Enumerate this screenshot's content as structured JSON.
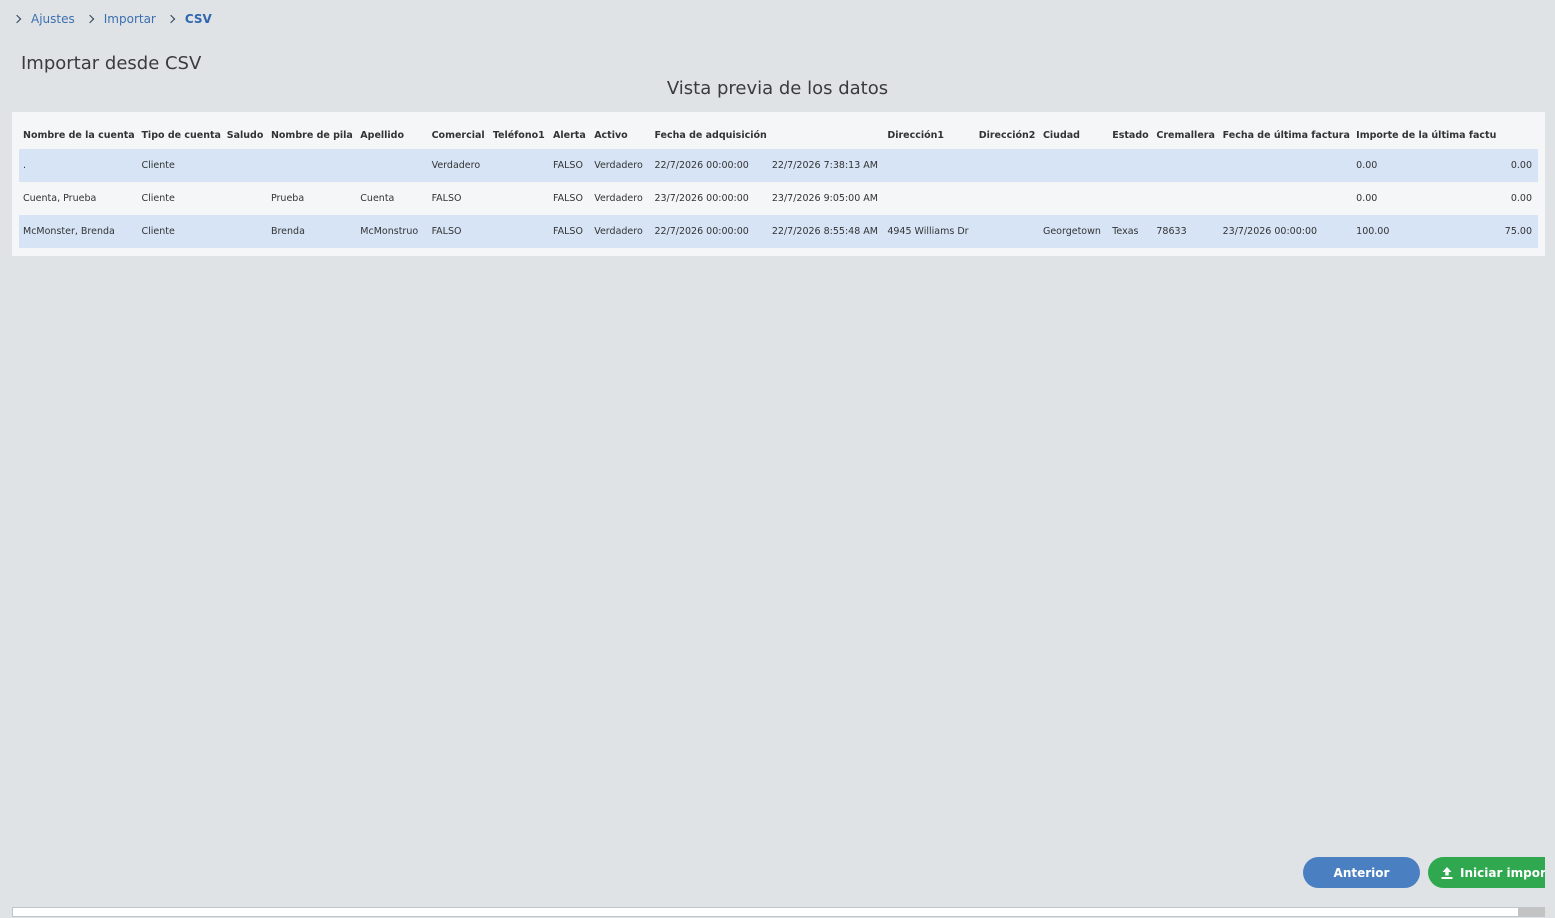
{
  "breadcrumb": {
    "items": [
      "Ajustes",
      "Importar",
      "CSV"
    ]
  },
  "page_title": "Importar desde CSV",
  "preview_title": "Vista previa de los datos",
  "table": {
    "headers": [
      "Nombre de la cuenta",
      "Tipo de cuenta",
      "Saludo",
      "Nombre de pila",
      "Apellido",
      "Comercial",
      "Teléfono1",
      "Alerta",
      "Activo",
      "Fecha de adquisición",
      "",
      "Dirección1",
      "Dirección2",
      "Ciudad",
      "Estado",
      "Cremallera",
      "Fecha de última factura",
      "Importe de la última factura",
      ""
    ],
    "rows": [
      [
        ".",
        "Cliente",
        "",
        "",
        "",
        "Verdadero",
        "",
        "FALSO",
        "Verdadero",
        "22/7/2026 00:00:00",
        "22/7/2026 7:38:13 AM",
        "",
        "",
        "",
        "",
        "",
        "",
        "0.00",
        "0.00"
      ],
      [
        "Cuenta, Prueba",
        "Cliente",
        "",
        "Prueba",
        "Cuenta",
        "FALSO",
        "",
        "FALSO",
        "Verdadero",
        "23/7/2026 00:00:00",
        "23/7/2026 9:05:00 AM",
        "",
        "",
        "",
        "",
        "",
        "",
        "0.00",
        "0.00"
      ],
      [
        "McMonster, Brenda",
        "Cliente",
        "",
        "Brenda",
        "McMonstruo",
        "FALSO",
        "",
        "FALSO",
        "Verdadero",
        "22/7/2026 00:00:00",
        "22/7/2026 8:55:48 AM",
        "4945 Williams Dr",
        "",
        "Georgetown",
        "Texas",
        "78633",
        "23/7/2026 00:00:00",
        "100.00",
        "75.00"
      ]
    ]
  },
  "buttons": {
    "previous": "Anterior",
    "start_import": "Iniciar importación"
  },
  "colors": {
    "accent_blue": "#4a7fc1",
    "accent_green": "#2fa84f",
    "row_highlight": "#d6e4f6"
  }
}
